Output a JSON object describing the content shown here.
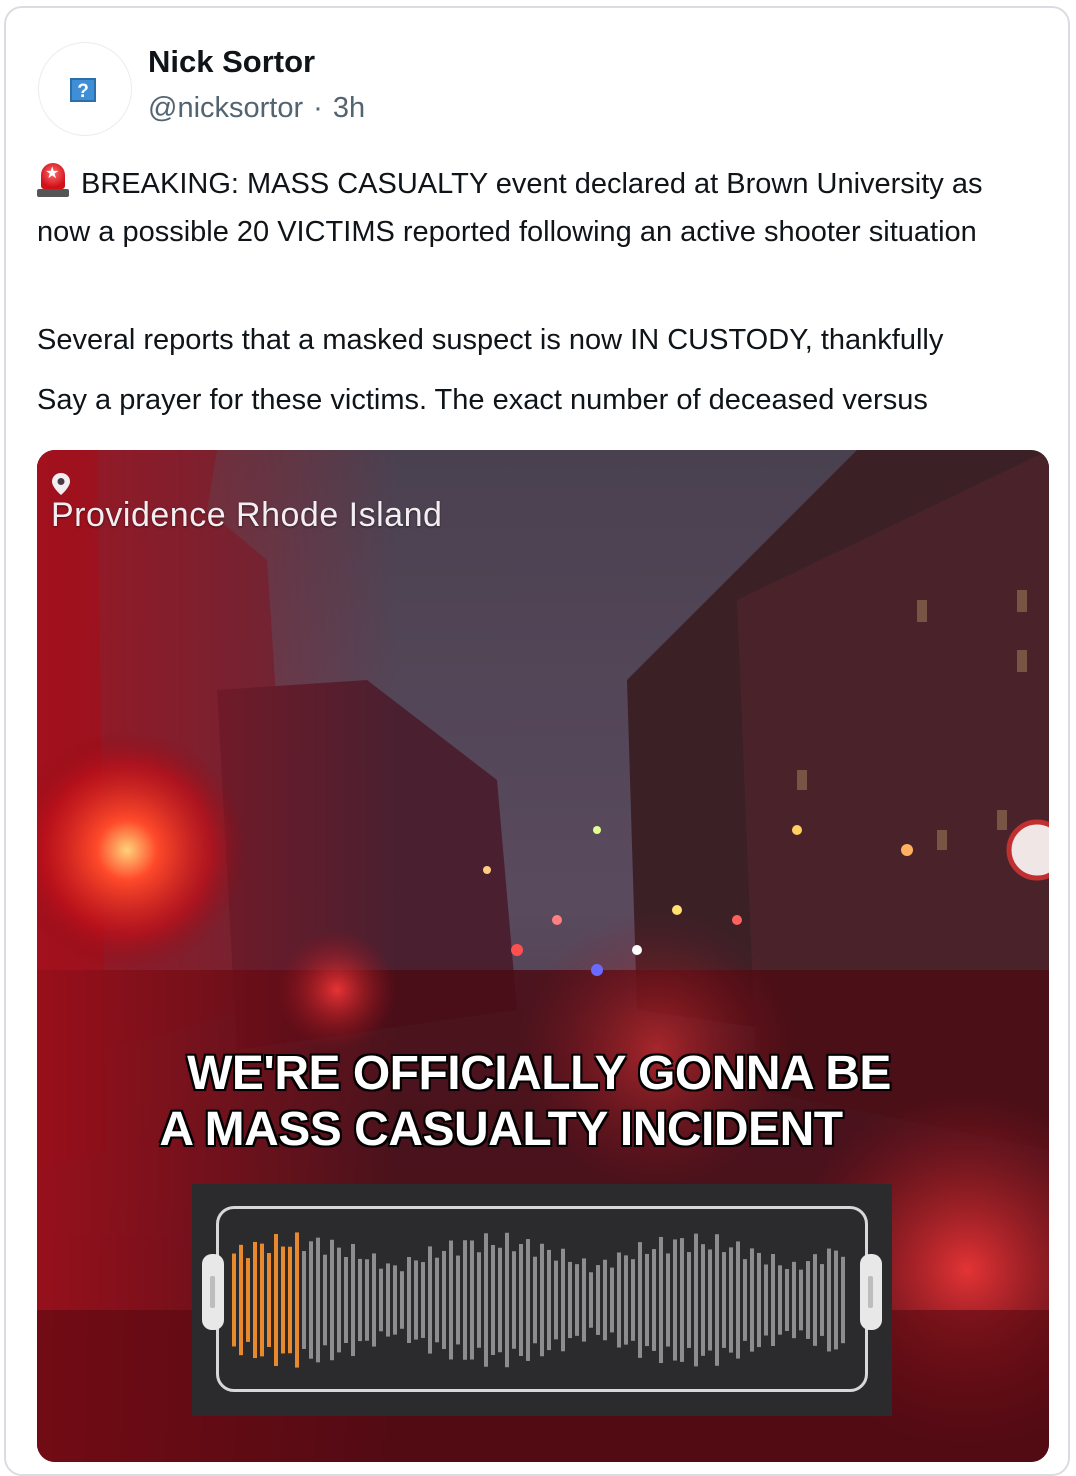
{
  "post": {
    "author_name": "Nick Sortor",
    "handle": "@nicksortor",
    "separator": "·",
    "time": "3h",
    "paragraph1": "BREAKING: MASS CASUALTY event declared at Brown University as now a possible 20 VICTIMS reported following an active shooter situation",
    "paragraph2": "Several reports that a masked suspect is now IN CUSTODY, thankfully",
    "paragraph3": "Say a prayer for these victims. The exact number of deceased versus",
    "emoji_icon": "police-car-light-icon",
    "avatar_placeholder": "?"
  },
  "media": {
    "location": "Providence Rhode Island",
    "caption_line1": "WE'RE OFFICIALLY GONNA BE",
    "caption_line2": "A MASS CASUALTY INCIDENT",
    "audio_progress": 0.11,
    "colors": {
      "progress": "#e8892e",
      "bars": "#8d8d8d",
      "panel": "#2b2a2c"
    }
  }
}
